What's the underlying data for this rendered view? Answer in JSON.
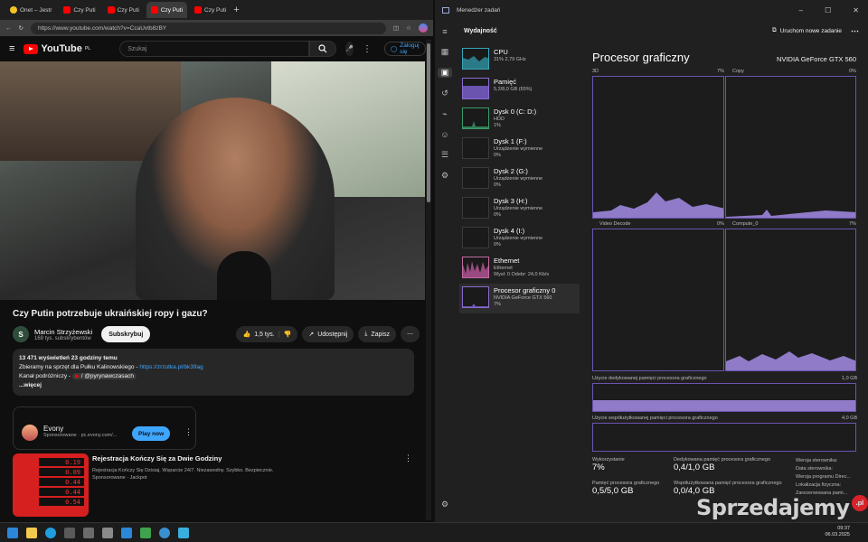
{
  "browser": {
    "tabs": [
      {
        "label": "Onet – Jestr",
        "color": "#f3c323"
      },
      {
        "label": "Czy Puti",
        "color": "#ff0000"
      },
      {
        "label": "Czy Puti",
        "color": "#ff0000"
      },
      {
        "label": "Czy Puti",
        "color": "#ff0000"
      },
      {
        "label": "Czy Puti",
        "color": "#ff0000"
      }
    ],
    "url": "https://www.youtube.com/watch?v=CcaUvtb8zBY"
  },
  "youtube": {
    "logo": "YouTube",
    "logo_region": "PL",
    "search_placeholder": "Szukaj",
    "login_label": "Zaloguj się",
    "video_title": "Czy Putin potrzebuje ukraińskiej ropy i gazu?",
    "channel_name": "Marcin Strzyżewski",
    "channel_subs": "169 tys. subskrybentów",
    "subscribe_label": "Subskrybuj",
    "likes": "1,5 tys.",
    "share_label": "Udostępnij",
    "save_label": "Zapisz",
    "desc_stats": "13 471 wyświetleń  23 godziny temu",
    "desc_line1": "Zbieramy na sprzęt dla Pułku Kalinowskiego - ",
    "desc_link": "https://zrzutka.pl/bk39ag",
    "desc_line2": "Kanał podróżniczy - ",
    "desc_handle": "/ @pyrynawczasach",
    "desc_more": "...więcej",
    "ad1_name": "Evony",
    "ad1_sponsor": "Sponsorowane · pc.evony.com/...",
    "ad1_button": "Play now",
    "ad2_title": "Rejestracja Kończy Się za Dwie Godziny",
    "ad2_desc": "Rejestracja Kończy Się Dzisiaj. Wsparcie 24/7. Niezawodny. Szybko. Bezpiecznie.",
    "ad2_sponsor": "Sponsorowane · Jackpot",
    "ad2_prices": [
      "0.19",
      "0.09",
      "0.44",
      "0.44",
      "0.54"
    ]
  },
  "taskmanager": {
    "app_title": "Menedżer zadań",
    "section": "Wydajność",
    "new_task": "Uruchom nowe zadanie",
    "devices": [
      {
        "name": "CPU",
        "sub": "31%  2,79 GHz",
        "val": ""
      },
      {
        "name": "Pamięć",
        "sub": "5,2/8,0 GB (65%)",
        "val": ""
      },
      {
        "name": "Dysk 0 (C: D:)",
        "sub": "HDD",
        "val": "1%"
      },
      {
        "name": "Dysk 1 (F:)",
        "sub": "Urządzenie wymienne",
        "val": "0%"
      },
      {
        "name": "Dysk 2 (G:)",
        "sub": "Urządzenie wymienne",
        "val": "0%"
      },
      {
        "name": "Dysk 3 (H:)",
        "sub": "Urządzenie wymienne",
        "val": "0%"
      },
      {
        "name": "Dysk 4 (I:)",
        "sub": "Urządzenie wymienne",
        "val": "0%"
      },
      {
        "name": "Ethernet",
        "sub": "Ethernet",
        "val": "Wysł: 0 Odebr: 24,0 Kb/s"
      },
      {
        "name": "Procesor graficzny 0",
        "sub": "NVIDIA GeForce GTX 560",
        "val": "7%"
      }
    ],
    "gpu_title": "Procesor graficzny",
    "gpu_model": "NVIDIA GeForce GTX 560",
    "graphs": {
      "g3d": {
        "label": "3D",
        "value": "7%"
      },
      "copy": {
        "label": "Copy",
        "value": "0%"
      },
      "vdecode": {
        "label": "Video Decode",
        "value": "0%"
      },
      "compute": {
        "label": "Compute_0",
        "value": "7%"
      }
    },
    "dedicated_label": "Użycie dedykowanej pamięci procesora graficznego",
    "dedicated_max": "1,0 GB",
    "shared_label": "Użycie współużytkowanej pamięci procesora graficznego",
    "shared_max": "4,0 GB",
    "stats": {
      "usage_label": "Wykorzystanie",
      "usage_val": "7%",
      "ded_label": "Dedykowana pamięć procesora graficznego",
      "ded_val": "0,4/1,0 GB",
      "gpu_mem_label": "Pamięć procesora graficznego",
      "gpu_mem_val": "0,5/5,0 GB",
      "shared_label": "Współużytkowana pamięć procesora graficznego",
      "shared_val": "0,0/4,0 GB",
      "driver_ver": "Wersja sterownika:",
      "driver_date": "Data sterownika:",
      "directx": "Wersja programu Direc...",
      "location": "Lokalizacja fizyczna:",
      "reserved": "Zarezerwowana pami..."
    }
  },
  "taskbar": {
    "time": "09:37",
    "date": "06.03.2025"
  },
  "watermark": {
    "text": "Sprzedajemy",
    "suffix": ".pl"
  }
}
